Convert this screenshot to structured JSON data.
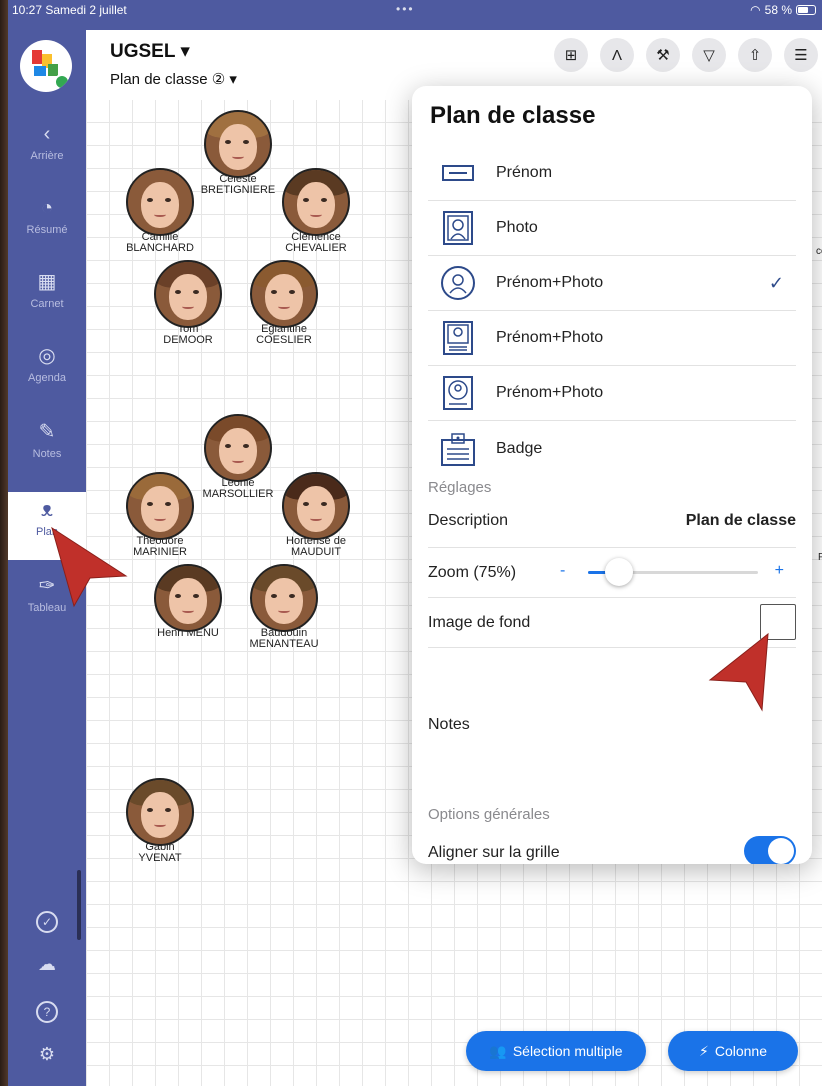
{
  "status_bar": {
    "time": "10:27  Samedi 2 juillet",
    "dots": "•••",
    "battery": "58 %"
  },
  "sidebar": {
    "items": [
      {
        "label": "Arrière",
        "icon": "chevron-left-icon",
        "glyph": "‹"
      },
      {
        "label": "Résumé",
        "icon": "pie-chart-icon",
        "glyph": "◔"
      },
      {
        "label": "Carnet",
        "icon": "grid-icon",
        "glyph": "▦"
      },
      {
        "label": "Agenda",
        "icon": "chat-icon",
        "glyph": "◎"
      },
      {
        "label": "Notes",
        "icon": "pencil-icon",
        "glyph": "✎"
      },
      {
        "label": "Plan",
        "icon": "people-icon",
        "glyph": "ᴥ"
      },
      {
        "label": "Tableau",
        "icon": "pin-icon",
        "glyph": "✑"
      }
    ],
    "bottom": [
      "✓",
      "☁",
      "?",
      "⚙"
    ]
  },
  "header": {
    "title": "UGSEL ▾",
    "subtitle": "Plan de classe ② ▾"
  },
  "toolbar": [
    {
      "icon": "calculator-icon",
      "glyph": "⊞"
    },
    {
      "icon": "compass-icon",
      "glyph": "Λ"
    },
    {
      "icon": "hammer-icon",
      "glyph": "⚒"
    },
    {
      "icon": "filter-icon",
      "glyph": "▽"
    },
    {
      "icon": "share-icon",
      "glyph": "⇧"
    },
    {
      "icon": "toggle-settings-icon",
      "glyph": "☰"
    }
  ],
  "students": [
    {
      "first": "Céleste",
      "last": "BRETIGNIERE"
    },
    {
      "first": "Camille",
      "last": "BLANCHARD"
    },
    {
      "first": "Clémence",
      "last": "CHEVALIER"
    },
    {
      "first": "Tom",
      "last": "DEMOOR"
    },
    {
      "first": "Eglantine",
      "last": "COESLIER"
    },
    {
      "first": "Léonie",
      "last": "MARSOLLIER"
    },
    {
      "first": "Théodore",
      "last": "MARINIER"
    },
    {
      "first": "Hortense de",
      "last": "MAUDUIT"
    },
    {
      "first": "",
      "last": "Henri MENU"
    },
    {
      "first": "Baudouin",
      "last": "MENANTEAU"
    },
    {
      "first": "Gabin",
      "last": "YVENAT"
    }
  ],
  "edge_labels": {
    "top": "co",
    "middle": "F"
  },
  "popover": {
    "title": "Plan de classe",
    "options": [
      {
        "label": "Prénom",
        "icon": "name-tag-icon",
        "checked": false
      },
      {
        "label": "Photo",
        "icon": "photo-frame-icon",
        "checked": false
      },
      {
        "label": "Prénom+Photo",
        "icon": "round-photo-icon",
        "checked": true
      },
      {
        "label": "Prénom+Photo",
        "icon": "framed-photo-name-icon",
        "checked": false
      },
      {
        "label": "Prénom+Photo",
        "icon": "framed-round-photo-icon",
        "checked": false
      },
      {
        "label": "Badge",
        "icon": "badge-icon",
        "checked": false
      }
    ],
    "check_glyph": "✓",
    "settings_header": "Réglages",
    "description_label": "Description",
    "description_value": "Plan de classe",
    "zoom_label": "Zoom (75%)",
    "zoom_minus": "-",
    "zoom_plus": "+",
    "zoom_level": 0.18,
    "background_label": "Image de fond",
    "background_checked": false,
    "notes_label": "Notes",
    "general_header": "Options générales",
    "grid_label": "Aligner sur la grille",
    "grid_enabled": true
  },
  "bottom_buttons": {
    "multi_select": "Sélection multiple",
    "column": "Colonne"
  },
  "colors": {
    "sidebar": "#4e5aa0",
    "accent": "#1a73e8",
    "annotation_arrow": "#c0302a"
  }
}
